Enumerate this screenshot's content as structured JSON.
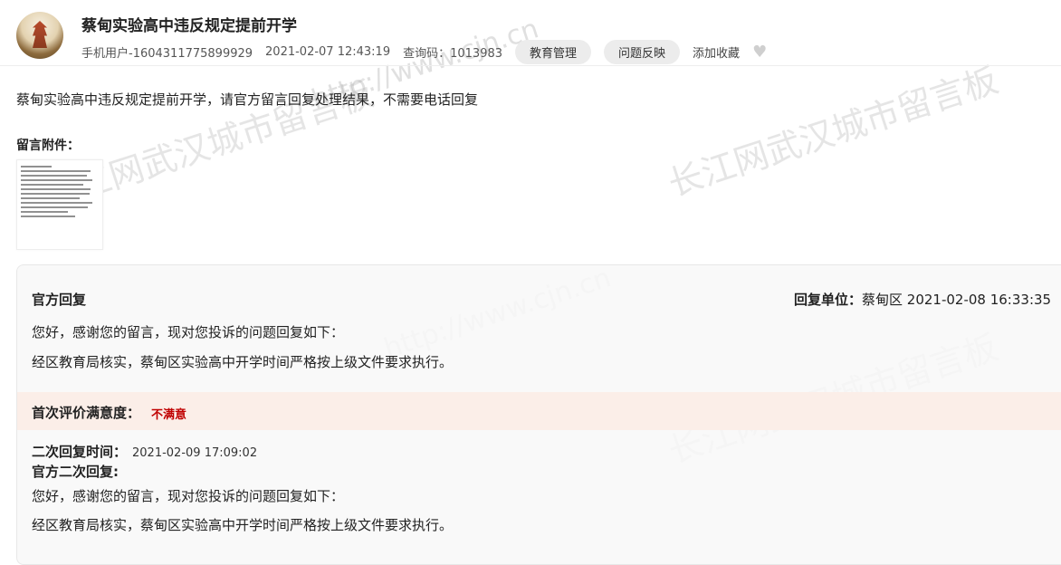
{
  "watermark": {
    "brand": "长江网武汉城市留言板",
    "url": "http://www.cjn.cn"
  },
  "header": {
    "title": "蔡甸实验高中违反规定提前开学",
    "user": "手机用户-1604311775899929",
    "datetime": "2021-02-07 12:43:19",
    "query_code": "查询码：1013983",
    "tags": [
      "教育管理",
      "问题反映"
    ],
    "favorite_label": "添加收藏"
  },
  "question": {
    "text": "蔡甸实验高中违反规定提前开学，请官方留言回复处理结果，不需要电话回复",
    "attachment_label": "留言附件："
  },
  "reply": {
    "title": "官方回复",
    "unit_label": "回复单位：",
    "unit_value": "蔡甸区 2021-02-08 16:33:35",
    "line1": "您好，感谢您的留言，现对您投诉的问题回复如下：",
    "line2": "经区教育局核实，蔡甸区实验高中开学时间严格按上级文件要求执行。",
    "eval_label": "首次评价满意度：",
    "eval_value": "不满意",
    "second_time_label": "二次回复时间：",
    "second_time_value": "2021-02-09 17:09:02",
    "second_title": "官方二次回复:",
    "second_line1": "您好，感谢您的留言，现对您投诉的问题回复如下：",
    "second_line2": "经区教育局核实，蔡甸区实验高中开学时间严格按上级文件要求执行。"
  }
}
